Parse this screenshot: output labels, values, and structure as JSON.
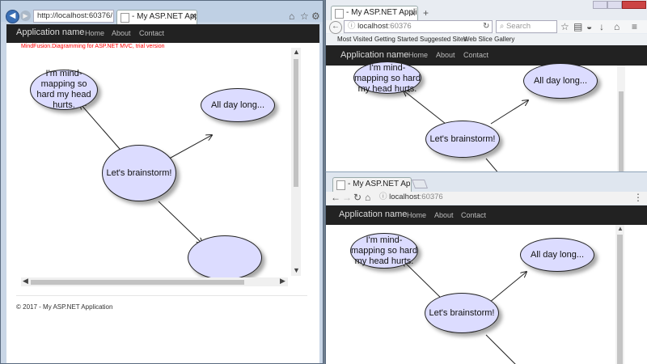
{
  "ie": {
    "url": "http://localhost:60376/",
    "tab_title": "- My ASP.NET Application",
    "brand": "Application name",
    "nav": [
      "Home",
      "About",
      "Contact"
    ],
    "trial_notice": "MindFusion.Diagramming for ASP.NET MVC, trial version",
    "footer": "© 2017 - My ASP.NET Application"
  },
  "firefox": {
    "tab_title": "- My ASP.NET Application",
    "url_host": "localhost",
    "url_port": ":60376",
    "search_placeholder": "Search",
    "bookmarks": [
      "Most Visited",
      "Getting Started",
      "Suggested Sites",
      "Web Slice Gallery"
    ],
    "brand": "Application name",
    "nav": [
      "Home",
      "About",
      "Contact"
    ]
  },
  "chrome": {
    "tab_title": "- My ASP.NET Applicatio",
    "url_host": "localhost",
    "url_port": ":60376",
    "brand": "Application name",
    "nav": [
      "Home",
      "About",
      "Contact"
    ]
  },
  "diagram": {
    "nodes": {
      "center": "Let's brainstorm!",
      "mind": "I'm mind-mapping so hard my head hurts.",
      "day": "All day long...",
      "empty": ""
    }
  },
  "icons": {
    "back": "back-arrow-icon",
    "forward": "forward-arrow-icon",
    "reload": "reload-icon",
    "home": "home-icon",
    "star": "star-icon",
    "settings": "gear-icon",
    "menu": "hamburger-menu-icon",
    "download": "download-icon"
  },
  "colors": {
    "navbar": "#222222",
    "node_fill": "#dcdcff",
    "trial_text": "#ff0000"
  }
}
